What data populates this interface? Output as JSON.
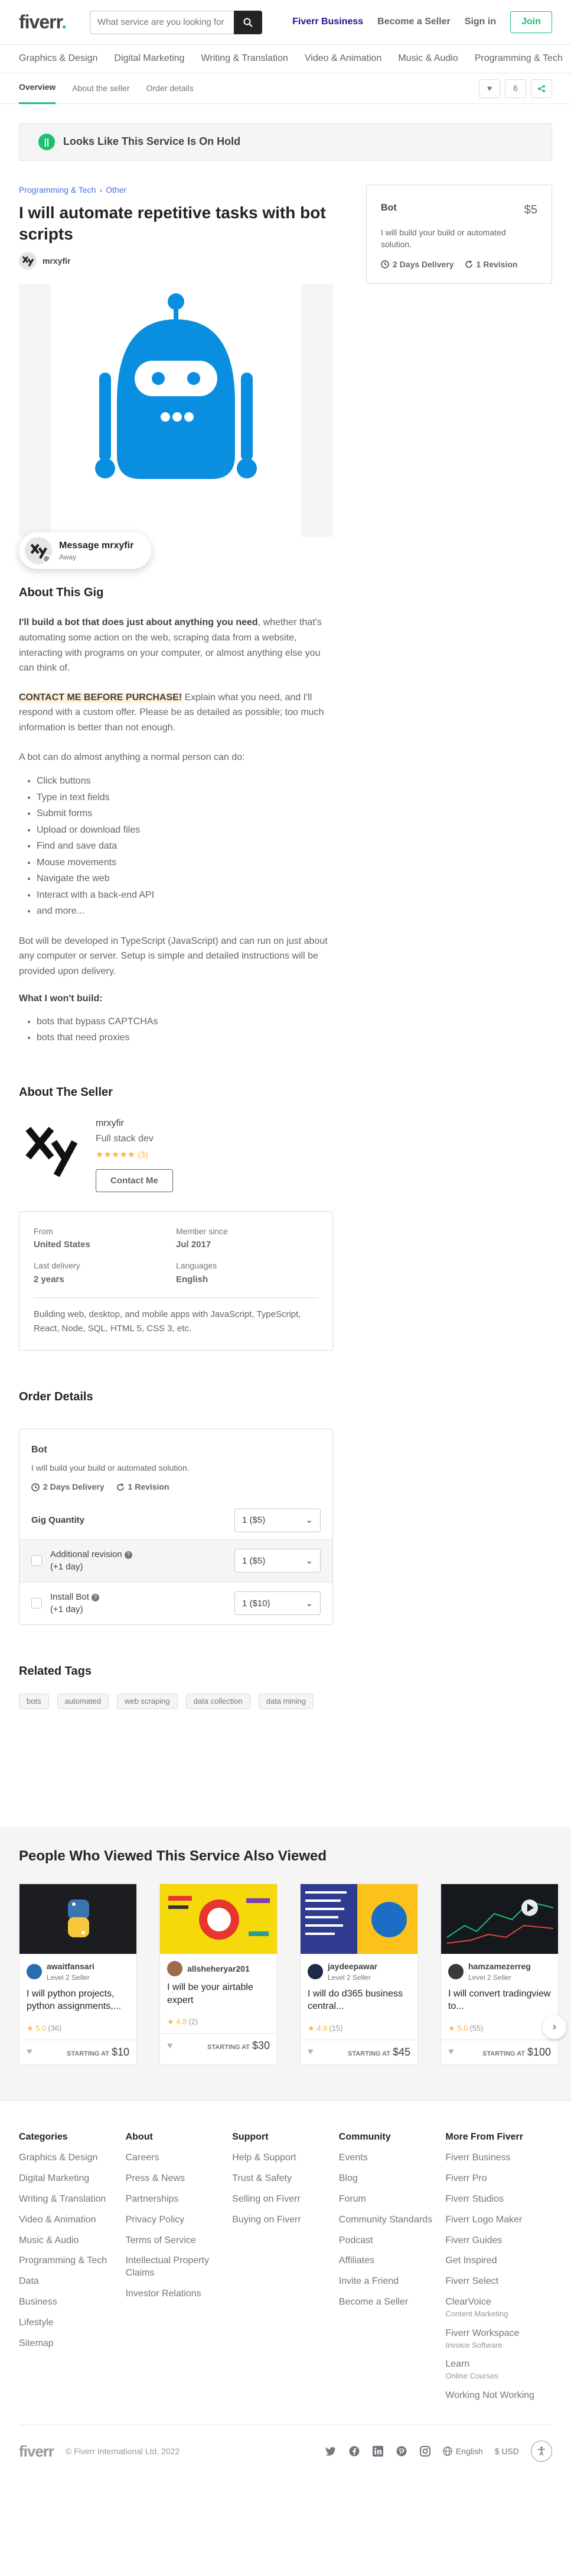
{
  "header": {
    "logo_text": "fiverr",
    "logo_dot": ".",
    "search_placeholder": "What service are you looking for today?",
    "fiverr_business": "Fiverr Business",
    "become_seller": "Become a Seller",
    "sign_in": "Sign in",
    "join": "Join"
  },
  "categories": [
    "Graphics & Design",
    "Digital Marketing",
    "Writing & Translation",
    "Video & Animation",
    "Music & Audio",
    "Programming & Tech"
  ],
  "gig_nav": {
    "tabs": [
      "Overview",
      "About the seller",
      "Order details"
    ],
    "like_count": "6"
  },
  "notice": {
    "icon": "||",
    "text": "Looks Like This Service Is On Hold"
  },
  "breadcrumb": {
    "cat": "Programming & Tech",
    "sub": "Other"
  },
  "gig": {
    "title": "I will automate repetitive tasks with bot scripts",
    "seller": "mrxyfir"
  },
  "message_pill": {
    "name": "Message mrxyfir",
    "status": "Away"
  },
  "about": {
    "heading": "About This Gig",
    "p1_bold": "I'll build a bot that does just about anything you need",
    "p1_rest": ", whether that's automating some action on the web, scraping data from a website, interacting with programs on your computer, or almost anything else you can think of.",
    "p2_hl": "CONTACT ME BEFORE PURCHASE!",
    "p2_rest": " Explain what you need, and I'll respond with a custom offer. Please be as detailed as possible; too much information is better than not enough.",
    "p3": "A bot can do almost anything a normal person can do:",
    "list": [
      "Click buttons",
      "Type in text fields",
      "Submit forms",
      "Upload or download files",
      "Find and save data",
      "Mouse movements",
      "Navigate the web",
      "Interact with a back-end API",
      "and more..."
    ],
    "p4": "Bot will be developed in TypeScript (JavaScript) and can run on just about any computer or server. Setup is simple and detailed instructions will be provided upon delivery.",
    "wont_heading": "What I won't build:",
    "wont_list": [
      "bots that bypass CAPTCHAs",
      "bots that need proxies"
    ]
  },
  "seller_section": {
    "heading": "About The Seller",
    "name": "mrxyfir",
    "tagline": "Full stack dev",
    "stars": "★★★★★",
    "rating_count": "(3)",
    "contact": "Contact Me",
    "stats": [
      {
        "k": "From",
        "v": "United States"
      },
      {
        "k": "Member since",
        "v": "Jul 2017"
      },
      {
        "k": "Last delivery",
        "v": "2 years"
      },
      {
        "k": "Languages",
        "v": "English"
      }
    ],
    "desc": "Building web, desktop, and mobile apps with JavaScript, TypeScript, React, Node, SQL, HTML 5, CSS 3, etc."
  },
  "order": {
    "heading": "Order Details",
    "title": "Bot",
    "desc": "I will build your build or automated solution.",
    "delivery": "2 Days Delivery",
    "revisions": "1 Revision",
    "rows": [
      {
        "label": "Gig Quantity",
        "value": "1 ($5)"
      },
      {
        "label": "Additional revision",
        "sub": "(+1 day)",
        "value": "1 ($5)"
      },
      {
        "label": "Install Bot",
        "sub": "(+1 day)",
        "value": "1 ($10)"
      }
    ]
  },
  "tags_section": {
    "heading": "Related Tags",
    "tags": [
      "bots",
      "automated",
      "web scraping",
      "data collection",
      "data mining"
    ]
  },
  "price_card": {
    "title": "Bot",
    "price": "$5",
    "desc": "I will build your build or automated solution.",
    "delivery": "2 Days Delivery",
    "revisions": "1 Revision"
  },
  "also_viewed": {
    "heading": "People Who Viewed This Service Also Viewed",
    "starting_at": "STARTING AT",
    "cards": [
      {
        "seller": "awaitfansari",
        "level": "Level 2 Seller",
        "title": "I will python projects, python assignments,...",
        "rating": "5.0",
        "count": "(36)",
        "price": "$10",
        "img_bg": "#1c1d20",
        "avatar": "#2b6cb0"
      },
      {
        "seller": "allsheheryar201",
        "level": "",
        "title": "I will be your airtable expert",
        "rating": "4.8",
        "count": "(2)",
        "price": "$30",
        "img_bg": "#f5d90a",
        "avatar": "#9b6b4a"
      },
      {
        "seller": "jaydeepawar",
        "level": "Level 2 Seller",
        "title": "I will do d365 business central...",
        "rating": "4.9",
        "count": "(15)",
        "price": "$45",
        "img_bg": "#fcc21b",
        "avatar": "#1f2a44"
      },
      {
        "seller": "hamzamezerreg",
        "level": "Level 2 Seller",
        "title": "I will convert tradingview to...",
        "rating": "5.0",
        "count": "(55)",
        "price": "$100",
        "img_bg": "#15181d",
        "avatar": "#3a3a3a"
      }
    ]
  },
  "footer": {
    "columns": [
      {
        "heading": "Categories",
        "items": [
          {
            "t": "Graphics & Design"
          },
          {
            "t": "Digital Marketing"
          },
          {
            "t": "Writing & Translation"
          },
          {
            "t": "Video & Animation"
          },
          {
            "t": "Music & Audio"
          },
          {
            "t": "Programming & Tech"
          },
          {
            "t": "Data"
          },
          {
            "t": "Business"
          },
          {
            "t": "Lifestyle"
          },
          {
            "t": "Sitemap"
          }
        ]
      },
      {
        "heading": "About",
        "items": [
          {
            "t": "Careers"
          },
          {
            "t": "Press & News"
          },
          {
            "t": "Partnerships"
          },
          {
            "t": "Privacy Policy"
          },
          {
            "t": "Terms of Service"
          },
          {
            "t": "Intellectual Property Claims"
          },
          {
            "t": "Investor Relations"
          }
        ]
      },
      {
        "heading": "Support",
        "items": [
          {
            "t": "Help & Support"
          },
          {
            "t": "Trust & Safety"
          },
          {
            "t": "Selling on Fiverr"
          },
          {
            "t": "Buying on Fiverr"
          }
        ]
      },
      {
        "heading": "Community",
        "items": [
          {
            "t": "Events"
          },
          {
            "t": "Blog"
          },
          {
            "t": "Forum"
          },
          {
            "t": "Community Standards"
          },
          {
            "t": "Podcast"
          },
          {
            "t": "Affiliates"
          },
          {
            "t": "Invite a Friend"
          },
          {
            "t": "Become a Seller"
          }
        ]
      },
      {
        "heading": "More From Fiverr",
        "items": [
          {
            "t": "Fiverr Business"
          },
          {
            "t": "Fiverr Pro"
          },
          {
            "t": "Fiverr Studios"
          },
          {
            "t": "Fiverr Logo Maker"
          },
          {
            "t": "Fiverr Guides"
          },
          {
            "t": "Get Inspired"
          },
          {
            "t": "Fiverr Select"
          },
          {
            "t": "ClearVoice",
            "s": "Content Marketing"
          },
          {
            "t": "Fiverr Workspace",
            "s": "Invoice Software"
          },
          {
            "t": "Learn",
            "s": "Online Courses"
          },
          {
            "t": "Working Not Working"
          }
        ]
      }
    ],
    "logo": "fiverr",
    "copyright": "© Fiverr International Ltd. 2022",
    "language": "English",
    "currency": "$ USD"
  },
  "colors": {
    "brand_green": "#1dbf73",
    "robot_blue": "#0a8fe0",
    "star": "#ffb33e"
  }
}
